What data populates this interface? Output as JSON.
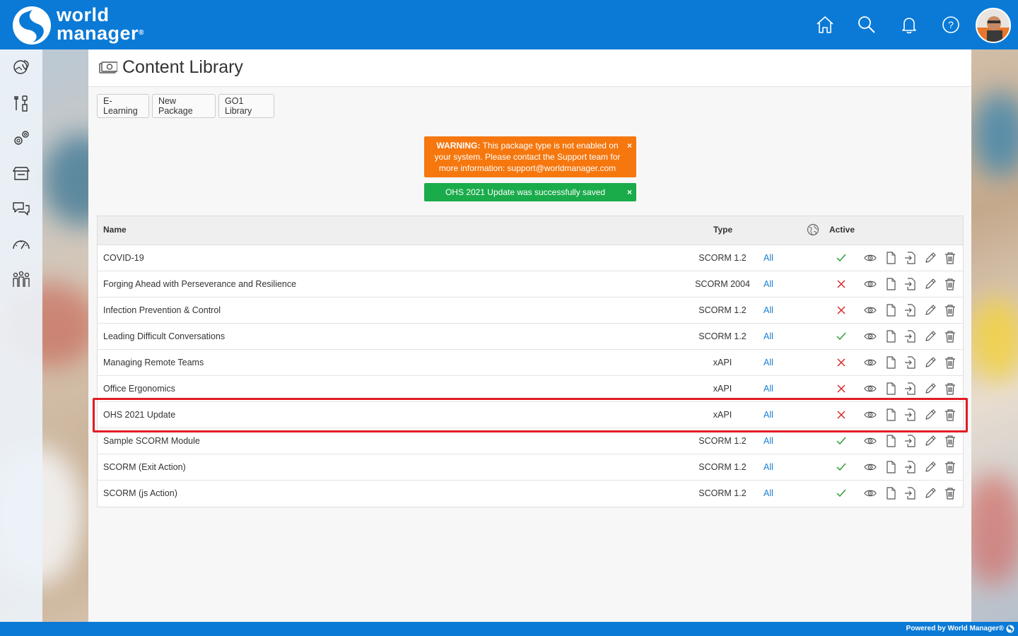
{
  "brand": {
    "line1": "world",
    "line2": "manager",
    "reg": "®"
  },
  "topbar": {
    "icons": [
      "home-icon",
      "search-icon",
      "bell-icon",
      "help-icon"
    ]
  },
  "sidebar": {
    "icons": [
      "map-pin-icon",
      "tools-icon",
      "gears-icon",
      "store-icon",
      "chat-icon",
      "dashboard-icon",
      "people-icon"
    ],
    "expand_label": "»"
  },
  "page": {
    "title": "Content Library"
  },
  "tabs": [
    "E-Learning",
    "New Package",
    "GO1 Library"
  ],
  "alerts": {
    "warning": {
      "strong": "WARNING:",
      "text": " This package type is not enabled on your system. Please contact the Support team for more information: support@worldmanager.com",
      "close": "×"
    },
    "success": {
      "text": "OHS 2021 Update was successfully saved",
      "close": "×"
    }
  },
  "table": {
    "headers": {
      "name": "Name",
      "type": "Type",
      "active": "Active"
    },
    "rows": [
      {
        "name": "COVID-19",
        "type": "SCORM 1.2",
        "scope": "All",
        "active": true
      },
      {
        "name": "Forging Ahead with Perseverance and Resilience",
        "type": "SCORM 2004",
        "scope": "All",
        "active": false
      },
      {
        "name": "Infection Prevention & Control",
        "type": "SCORM 1.2",
        "scope": "All",
        "active": false
      },
      {
        "name": "Leading Difficult Conversations",
        "type": "SCORM 1.2",
        "scope": "All",
        "active": true
      },
      {
        "name": "Managing Remote Teams",
        "type": "xAPI",
        "scope": "All",
        "active": false
      },
      {
        "name": "Office Ergonomics",
        "type": "xAPI",
        "scope": "All",
        "active": false
      },
      {
        "name": "OHS 2021 Update",
        "type": "xAPI",
        "scope": "All",
        "active": false
      },
      {
        "name": "Sample SCORM Module",
        "type": "SCORM 1.2",
        "scope": "All",
        "active": true
      },
      {
        "name": "SCORM (Exit Action)",
        "type": "SCORM 1.2",
        "scope": "All",
        "active": true
      },
      {
        "name": "SCORM (js Action)",
        "type": "SCORM 1.2",
        "scope": "All",
        "active": true
      }
    ],
    "row_actions": [
      "view-icon",
      "copy-icon",
      "export-icon",
      "edit-icon",
      "delete-icon"
    ]
  },
  "colors": {
    "brand_blue": "#0a7ad6",
    "warning": "#f5770e",
    "success": "#1aab4b",
    "active_check": "#2e9e3c",
    "inactive_x": "#d62a2a",
    "highlight": "#e31b23",
    "link": "#1a7fd4"
  },
  "footer": {
    "text": "Powered by World Manager®"
  }
}
